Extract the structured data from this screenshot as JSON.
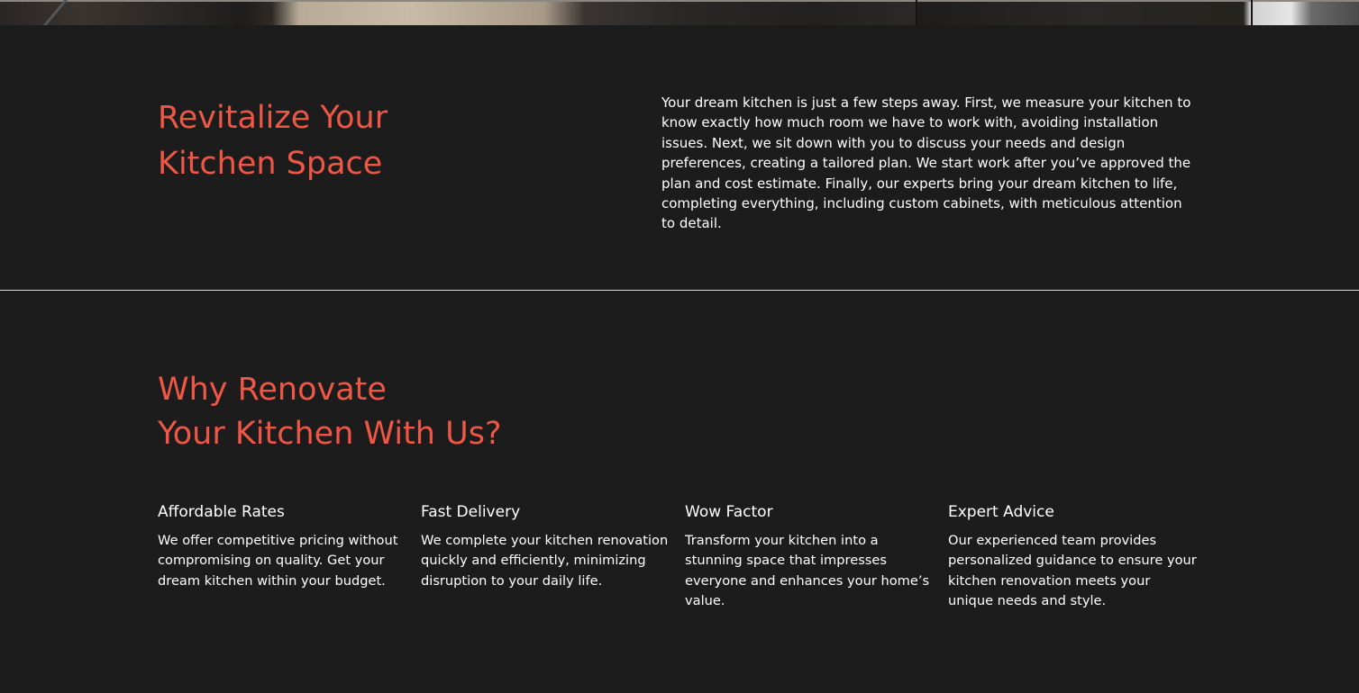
{
  "intro": {
    "title_line1": "Revitalize Your",
    "title_line2": "Kitchen Space",
    "body": "Your dream kitchen is just a few steps away. First, we measure your kitchen to know exactly how much room we have to work with, avoiding installation issues. Next, we sit down with you to discuss your needs and design preferences, creating a tailored plan. We start work after you’ve approved the plan and cost estimate. Finally, our experts bring your dream kitchen to life, completing everything, including custom cabinets, with meticulous attention to detail."
  },
  "why": {
    "title_line1": "Why Renovate",
    "title_line2": "Your Kitchen With Us?",
    "features": [
      {
        "title": "Affordable Rates",
        "text": "We offer competitive pricing without compromising on quality. Get your dream kitchen within your budget."
      },
      {
        "title": "Fast Delivery",
        "text": "We complete your kitchen renovation quickly and efficiently, minimizing disruption to your daily life."
      },
      {
        "title": "Wow Factor",
        "text": "Transform your kitchen into a stunning space that impresses everyone and enhances your home’s value."
      },
      {
        "title": "Expert Advice",
        "text": "Our experienced team provides personalized guidance to ensure your kitchen renovation meets your unique needs and style."
      }
    ]
  },
  "colors": {
    "background": "#1c1c1c",
    "accent": "#ee5745",
    "text": "#ffffff",
    "divider": "#d9d9d9"
  }
}
